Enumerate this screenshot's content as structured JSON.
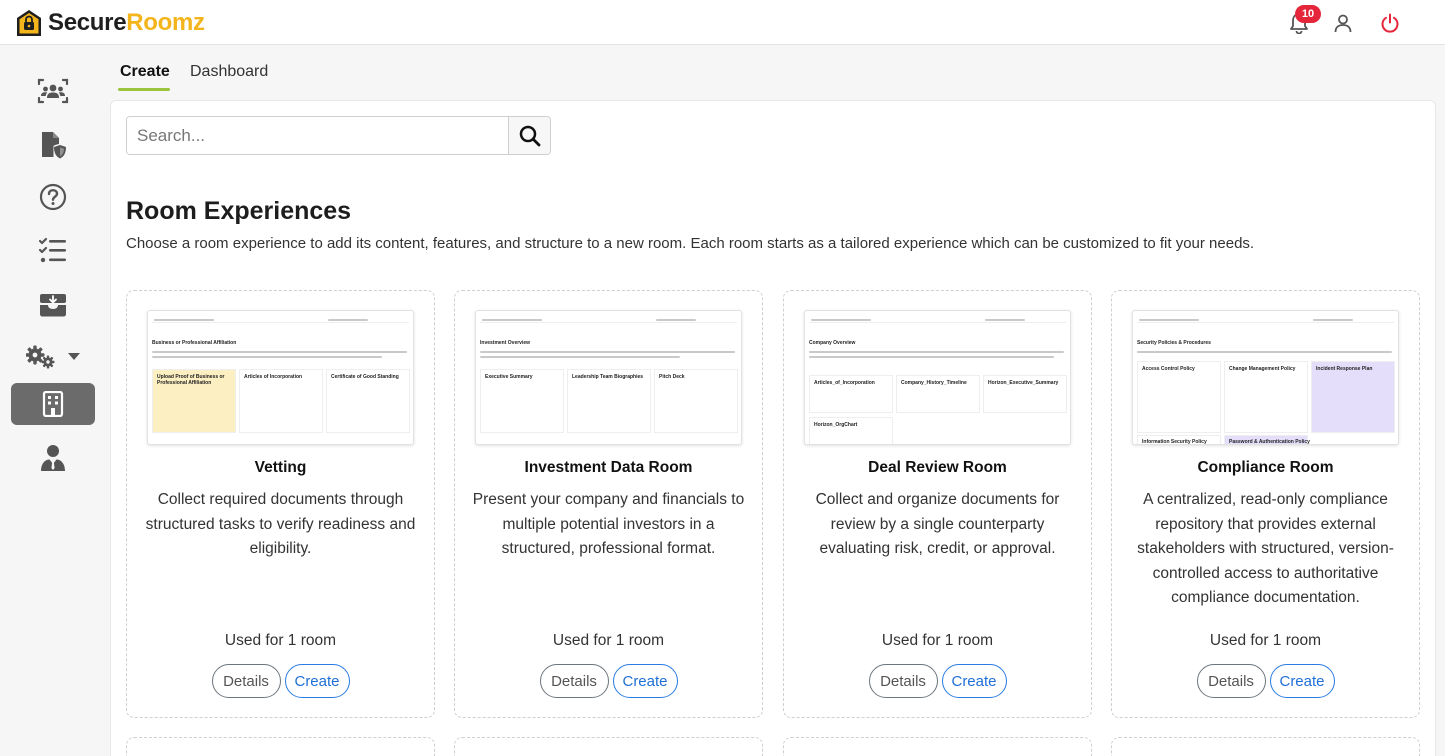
{
  "app": {
    "brand_part1": "Secure",
    "brand_part2": "Roomz"
  },
  "header": {
    "notification_count": "10"
  },
  "tabs": [
    {
      "label": "Create"
    },
    {
      "label": "Dashboard"
    }
  ],
  "search": {
    "placeholder": "Search..."
  },
  "section": {
    "title": "Room Experiences",
    "description": "Choose a room experience to add its content, features, and structure to a new room. Each room starts as a tailored experience which can be customized to fit your needs."
  },
  "cards": [
    {
      "title": "Vetting",
      "description": "Collect required documents through structured tasks to verify readiness and eligibility.",
      "usage": "Used for 1 room",
      "details_label": "Details",
      "create_label": "Create",
      "thumb_heading": "Business or Professional Affiliation",
      "thumb_items": [
        "Upload Proof of Business or Professional Affiliation",
        "Articles of Incorporation",
        "Certificate of Good Standing"
      ]
    },
    {
      "title": "Investment Data Room",
      "description": "Present your company and financials to multiple potential investors in a structured, professional format.",
      "usage": "Used for 1 room",
      "details_label": "Details",
      "create_label": "Create",
      "thumb_heading": "Investment Overview",
      "thumb_items": [
        "Executive Summary",
        "Leadership Team Biographies",
        "Pitch Deck"
      ]
    },
    {
      "title": "Deal Review Room",
      "description": "Collect and organize documents for review by a single counterparty evaluating risk, credit, or approval.",
      "usage": "Used for 1 room",
      "details_label": "Details",
      "create_label": "Create",
      "thumb_heading": "Company Overview",
      "thumb_items": [
        "Articles_of_Incorporation",
        "Company_History_Timeline",
        "Horizon_Executive_Summary",
        "Horizon_OrgChart"
      ]
    },
    {
      "title": "Compliance Room",
      "description": "A centralized, read-only compliance repository that provides external stakeholders with structured, version-controlled access to authoritative compliance documentation.",
      "usage": "Used for 1 room",
      "details_label": "Details",
      "create_label": "Create",
      "thumb_heading": "Security Policies & Procedures",
      "thumb_items": [
        "Access Control Policy",
        "Change Management Policy",
        "Incident Response Plan",
        "Information Security Policy",
        "Password & Authentication Policy"
      ]
    }
  ],
  "colors": {
    "accent": "#9ac43c",
    "brand_yellow": "#f3b51b",
    "primary": "#2a7be4",
    "danger": "#e5253a"
  }
}
